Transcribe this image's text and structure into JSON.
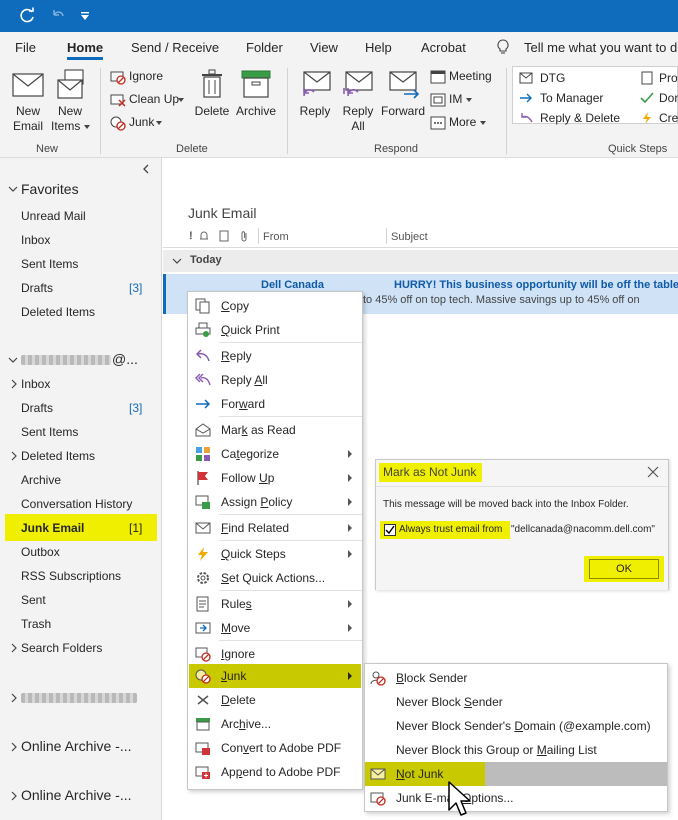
{
  "titlebar": {
    "icons": [
      "sync-icon",
      "undo-icon",
      "customize-icon"
    ]
  },
  "tabs": [
    "File",
    "Home",
    "Send / Receive",
    "Folder",
    "View",
    "Help",
    "Acrobat"
  ],
  "tell_me": "Tell me what you want to d",
  "ribbon": {
    "new_email": [
      "New",
      "Email"
    ],
    "new_items": [
      "New",
      "Items"
    ],
    "ignore": "Ignore",
    "clean_up": "Clean Up",
    "junk": "Junk",
    "delete": "Delete",
    "archive": "Archive",
    "reply": "Reply",
    "reply_all": [
      "Reply",
      "All"
    ],
    "forward": "Forward",
    "meeting": "Meeting",
    "im": "IM",
    "more": "More",
    "qs_dtg": "DTG",
    "qs_to_manager": "To Manager",
    "qs_reply_delete": "Reply & Delete",
    "qs_pro": "Pro",
    "qs_don": "Don",
    "qs_cre": "Cre",
    "groups": {
      "new": "New",
      "delete": "Delete",
      "respond": "Respond",
      "quick_steps": "Quick Steps"
    }
  },
  "folders": {
    "favorites": "Favorites",
    "fav_items": [
      "Unread Mail",
      "Inbox",
      "Sent Items",
      "Drafts",
      "Deleted Items"
    ],
    "fav_drafts_count": "[3]",
    "account_suffix": "@...",
    "acct_items": [
      "Inbox",
      "Drafts",
      "Sent Items",
      "Deleted Items",
      "Archive",
      "Conversation History",
      "Junk Email",
      "Outbox",
      "RSS Subscriptions",
      "Sent",
      "Trash",
      "Search Folders"
    ],
    "drafts_count": "[3]",
    "junk_count": "[1]",
    "online_archive_1": "Online Archive -...",
    "online_archive_2": "Online Archive -..."
  },
  "msglist": {
    "folder_title": "Junk Email",
    "col_from": "From",
    "col_subject": "Subject",
    "group_today": "Today",
    "sender": "Dell Canada",
    "subject": "HURRY! This business opportunity will be off the table s",
    "preview": "to 45% off on top tech.  Massive savings up to 45% off on"
  },
  "context_menu": [
    {
      "label": "Copy",
      "u": "C",
      "icon": "copy-icon"
    },
    {
      "label": "Quick Print",
      "u": "Q",
      "icon": "print-icon"
    },
    {
      "label": "Reply",
      "u": "R",
      "icon": "reply-icon"
    },
    {
      "label": "Reply All",
      "u": "A",
      "icon": "reply-all-icon"
    },
    {
      "label": "Forward",
      "u": "w",
      "icon": "forward-icon"
    },
    {
      "label": "Mark as Read",
      "u": "k",
      "icon": "mark-read-icon"
    },
    {
      "label": "Categorize",
      "u": "t",
      "icon": "categorize-icon"
    },
    {
      "label": "Follow Up",
      "u": "U",
      "icon": "flag-icon"
    },
    {
      "label": "Assign Policy",
      "u": "P",
      "icon": "policy-icon"
    },
    {
      "label": "Find Related",
      "u": "F",
      "icon": "find-related-icon"
    },
    {
      "label": "Quick Steps",
      "u": "Q",
      "icon": "lightning-icon"
    },
    {
      "label": "Set Quick Actions...",
      "u": "S",
      "icon": "gear-icon"
    },
    {
      "label": "Rules",
      "u": "s",
      "icon": "rules-icon"
    },
    {
      "label": "Move",
      "u": "M",
      "icon": "move-icon"
    },
    {
      "label": "Ignore",
      "u": "I",
      "icon": "ignore-icon"
    },
    {
      "label": "Junk",
      "u": "J",
      "icon": "junk-icon"
    },
    {
      "label": "Delete",
      "u": "D",
      "icon": "delete-icon"
    },
    {
      "label": "Archive...",
      "u": "h",
      "icon": "archive-icon"
    },
    {
      "label": "Convert to Adobe PDF",
      "u": "v",
      "icon": "pdf-icon"
    },
    {
      "label": "Append to Adobe PDF",
      "u": "p",
      "icon": "pdf-append-icon"
    }
  ],
  "junk_submenu": [
    {
      "label": "Block Sender",
      "u": "B"
    },
    {
      "label": "Never Block Sender",
      "u": "S"
    },
    {
      "label": "Never Block Sender's Domain (@example.com)",
      "u": "D"
    },
    {
      "label": "Never Block this Group or Mailing List",
      "u": "M"
    },
    {
      "label": "Not Junk",
      "u": "N"
    },
    {
      "label": "Junk E-mail Options...",
      "u": "O"
    }
  ],
  "dialog": {
    "title": "Mark as Not Junk",
    "message": "This message will be moved back into the Inbox Folder.",
    "checkbox_label": "Always trust email from",
    "sender_address": "\"dellcanada@nacomm.dell.com\"",
    "ok": "OK"
  },
  "colors": {
    "accent": "#0f6cbd",
    "highlight": "#f0ef00",
    "highlight_dark": "#c9c900"
  }
}
